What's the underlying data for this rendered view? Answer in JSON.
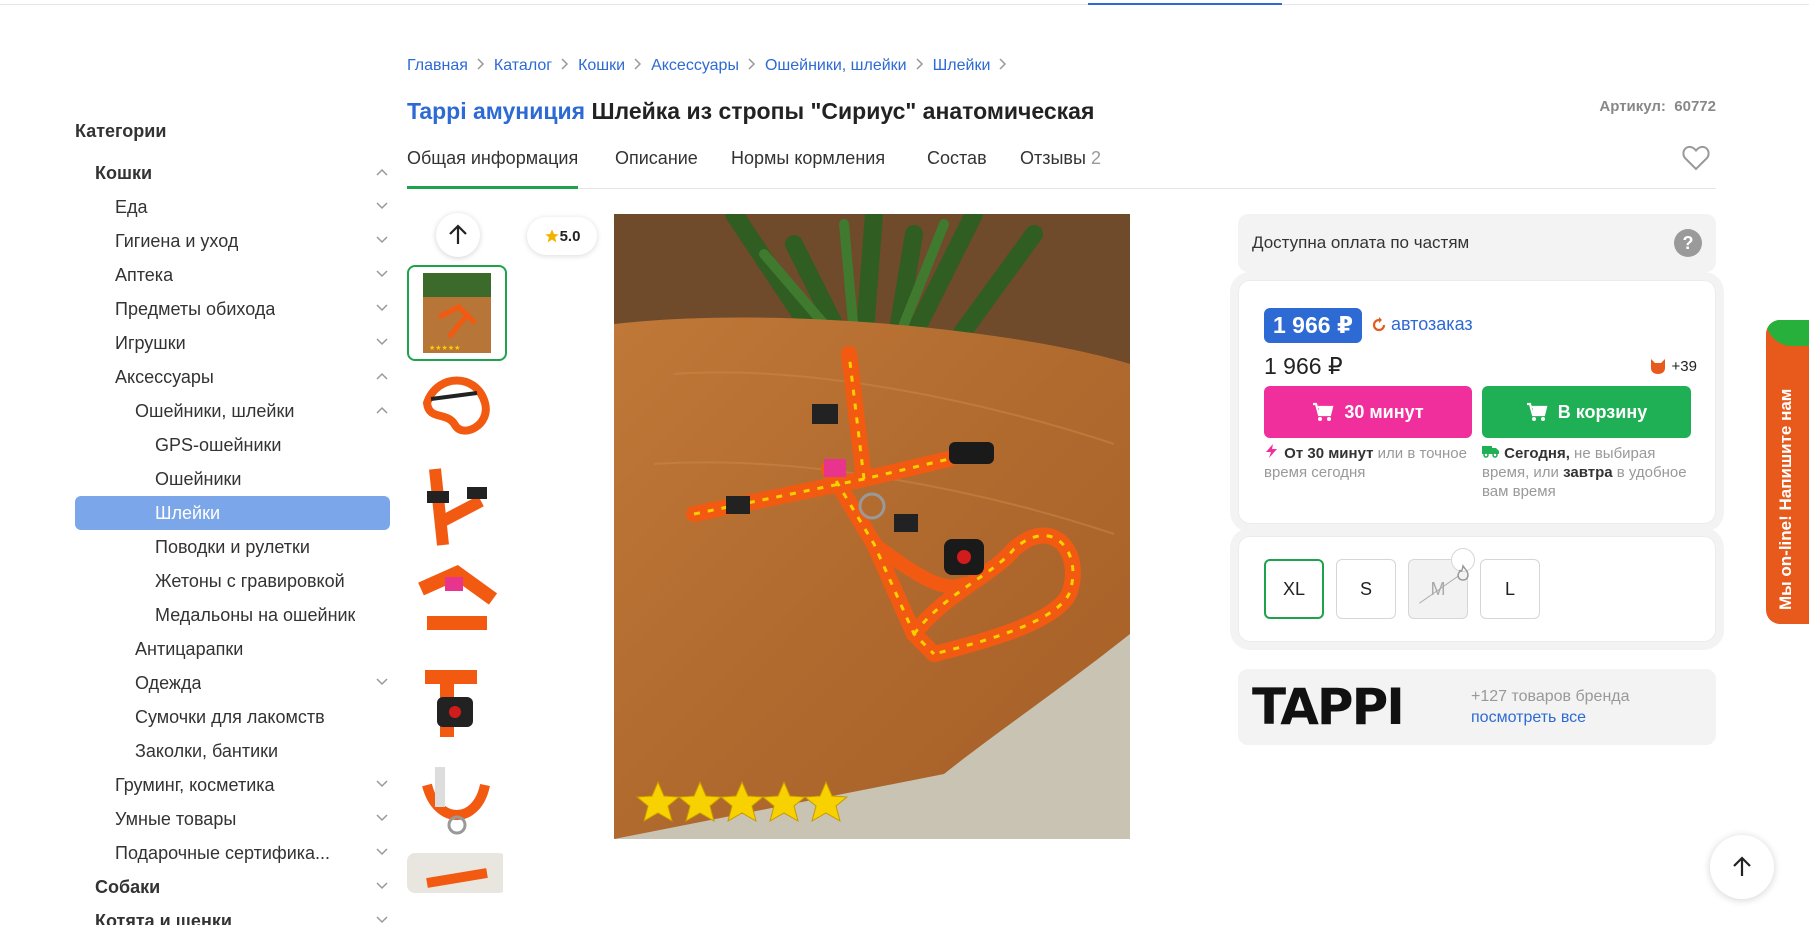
{
  "breadcrumbs": [
    "Главная",
    "Каталог",
    "Кошки",
    "Аксессуары",
    "Ошейники, шлейки",
    "Шлейки"
  ],
  "sidebar": {
    "title": "Категории",
    "items": [
      {
        "label": "Кошки",
        "level": 0,
        "expanded": true
      },
      {
        "label": "Еда",
        "level": 1,
        "expanded": false
      },
      {
        "label": "Гигиена и уход",
        "level": 1,
        "expanded": false
      },
      {
        "label": "Аптека",
        "level": 1,
        "expanded": false
      },
      {
        "label": "Предметы обихода",
        "level": 1,
        "expanded": false
      },
      {
        "label": "Игрушки",
        "level": 1,
        "expanded": false
      },
      {
        "label": "Аксессуары",
        "level": 1,
        "expanded": true
      },
      {
        "label": "Ошейники, шлейки",
        "level": 2,
        "expanded": true
      },
      {
        "label": "GPS-ошейники",
        "level": 3
      },
      {
        "label": "Ошейники",
        "level": 3
      },
      {
        "label": "Шлейки",
        "level": 3,
        "active": true
      },
      {
        "label": "Поводки и рулетки",
        "level": 3
      },
      {
        "label": "Жетоны с гравировкой",
        "level": 3
      },
      {
        "label": "Медальоны на ошейник",
        "level": 3
      },
      {
        "label": "Антицарапки",
        "level": 2
      },
      {
        "label": "Одежда",
        "level": 2,
        "expanded": false
      },
      {
        "label": "Сумочки для лакомств",
        "level": 2
      },
      {
        "label": "Заколки, бантики",
        "level": 2
      },
      {
        "label": "Груминг, косметика",
        "level": 1,
        "expanded": false
      },
      {
        "label": "Умные товары",
        "level": 1,
        "expanded": false
      },
      {
        "label": "Подарочные сертифика...",
        "level": 1,
        "expanded": false
      },
      {
        "label": "Собаки",
        "level": 0,
        "expanded": false
      },
      {
        "label": "Котята и щенки",
        "level": 0,
        "expanded": false
      }
    ]
  },
  "product": {
    "brand": "Tappi амуниция",
    "name": "Шлейка из стропы \"Сириус\" анатомическая",
    "article_label": "Артикул:",
    "article": "60772",
    "rating": "5.0"
  },
  "tabs": [
    {
      "label": "Общая информация",
      "active": true
    },
    {
      "label": "Описание"
    },
    {
      "label": "Нормы кормления"
    },
    {
      "label": "Состав"
    },
    {
      "label": "Отзывы",
      "count": "2"
    }
  ],
  "payment": {
    "installments": "Доступна оплата по частям",
    "help": "?"
  },
  "pricing": {
    "autoorder_price": "1 966 ₽",
    "autoorder_label": "автозаказ",
    "price": "1 966 ₽",
    "bonus": "+39",
    "fast_button": "30 минут",
    "cart_button": "В корзину",
    "fast_note_bold": "От 30 минут",
    "fast_note_rest": " или в точное время сегодня",
    "cart_note_bold1": "Сегодня,",
    "cart_note_mid": " не выбирая время, или ",
    "cart_note_bold2": "завтра",
    "cart_note_rest": " в удобное вам время"
  },
  "sizes": [
    {
      "label": "XL",
      "selected": true
    },
    {
      "label": "S"
    },
    {
      "label": "M",
      "disabled": true
    },
    {
      "label": "L"
    }
  ],
  "brand_block": {
    "logo": "TAPPI",
    "count": "+127 товаров бренда",
    "link": "посмотреть все"
  },
  "chat": {
    "label": "Мы on-line! Напишите нам"
  },
  "colors": {
    "accent": "#2d6ad4",
    "green": "#1faf55",
    "pink": "#f02f9c",
    "active_item": "#7ba6ea",
    "chat": "#e85a1c"
  }
}
